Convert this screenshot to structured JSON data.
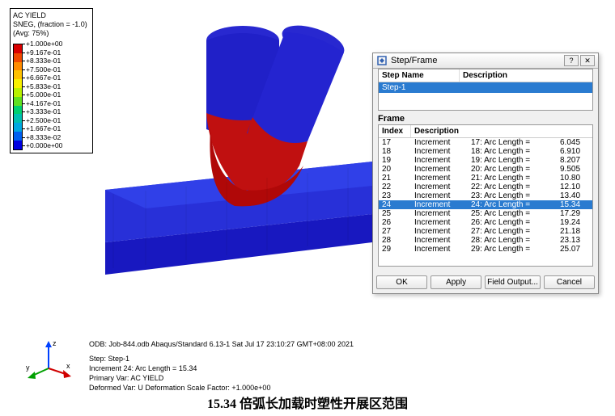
{
  "legend": {
    "title_l1": "AC YIELD",
    "title_l2": "SNEG, (fraction = -1.0)",
    "title_l3": "(Avg: 75%)",
    "ticks": [
      "+1.000e+00",
      "+9.167e-01",
      "+8.333e-01",
      "+7.500e-01",
      "+6.667e-01",
      "+5.833e-01",
      "+5.000e-01",
      "+4.167e-01",
      "+3.333e-01",
      "+2.500e-01",
      "+1.667e-01",
      "+8.333e-02",
      "+0.000e+00"
    ],
    "colors": [
      "#d90000",
      "#f04800",
      "#ff8c00",
      "#ffc100",
      "#f8f000",
      "#b8f000",
      "#60e020",
      "#00d070",
      "#00c0b0",
      "#00a8e0",
      "#0060f0",
      "#0000e0"
    ]
  },
  "dialog": {
    "title": "Step/Frame",
    "step_col1": "Step Name",
    "step_col2": "Description",
    "step_row": "Step-1",
    "frame_label": "Frame",
    "frame_col1": "Index",
    "frame_col2": "Description",
    "selected_index": 24,
    "frames": [
      {
        "idx": 17,
        "t": "Increment",
        "d": "17: Arc Length =",
        "v": "6.045"
      },
      {
        "idx": 18,
        "t": "Increment",
        "d": "18: Arc Length =",
        "v": "6.910"
      },
      {
        "idx": 19,
        "t": "Increment",
        "d": "19: Arc Length =",
        "v": "8.207"
      },
      {
        "idx": 20,
        "t": "Increment",
        "d": "20: Arc Length =",
        "v": "9.505"
      },
      {
        "idx": 21,
        "t": "Increment",
        "d": "21: Arc Length =",
        "v": "10.80"
      },
      {
        "idx": 22,
        "t": "Increment",
        "d": "22: Arc Length =",
        "v": "12.10"
      },
      {
        "idx": 23,
        "t": "Increment",
        "d": "23: Arc Length =",
        "v": "13.40"
      },
      {
        "idx": 24,
        "t": "Increment",
        "d": "24: Arc Length =",
        "v": "15.34"
      },
      {
        "idx": 25,
        "t": "Increment",
        "d": "25: Arc Length =",
        "v": "17.29"
      },
      {
        "idx": 26,
        "t": "Increment",
        "d": "26: Arc Length =",
        "v": "19.24"
      },
      {
        "idx": 27,
        "t": "Increment",
        "d": "27: Arc Length =",
        "v": "21.18"
      },
      {
        "idx": 28,
        "t": "Increment",
        "d": "28: Arc Length =",
        "v": "23.13"
      },
      {
        "idx": 29,
        "t": "Increment",
        "d": "29: Arc Length =",
        "v": "25.07"
      }
    ],
    "btn_ok": "OK",
    "btn_apply": "Apply",
    "btn_field": "Field Output...",
    "btn_cancel": "Cancel"
  },
  "info": {
    "odb": "ODB: Job-844.odb    Abaqus/Standard 6.13-1    Sat Jul 17 23:10:27 GMT+08:00 2021",
    "l1": "Step: Step-1",
    "l2": "Increment     24: Arc Length =    15.34",
    "l3": "Primary Var: AC YIELD",
    "l4": "Deformed Var: U   Deformation Scale Factor: +1.000e+00"
  },
  "axes": {
    "z": "z",
    "y": "y",
    "x": "x"
  },
  "caption": "15.34 倍弧长加载时塑性开展区范围"
}
